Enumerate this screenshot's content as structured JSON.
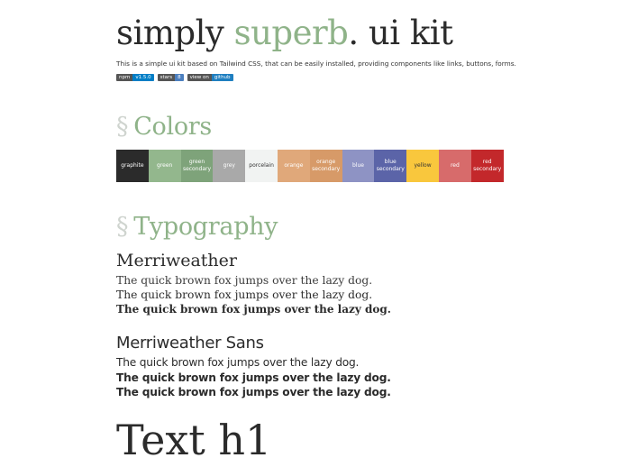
{
  "header": {
    "title_part1": "simply ",
    "title_accent": "superb",
    "title_part2": ". ui kit",
    "intro": "This is a simple ui kit based on Tailwind CSS, that can be easily installed, providing components like links, buttons, forms."
  },
  "badges": [
    {
      "key": "npm",
      "value": "v1.5.0"
    },
    {
      "key": "stars",
      "value": "8"
    },
    {
      "key": "view on",
      "value": "github"
    }
  ],
  "sections": {
    "colors_mark": "§",
    "colors_title": "Colors",
    "typography_mark": "§",
    "typography_title": "Typography"
  },
  "colors": [
    {
      "label": "graphite",
      "hex": "#2b2b2b"
    },
    {
      "label": "green",
      "hex": "#93b78d"
    },
    {
      "label": "green secondary",
      "hex": "#7ea37a"
    },
    {
      "label": "grey",
      "hex": "#a9a9a9"
    },
    {
      "label": "porcelain",
      "hex": "#f1f3f2"
    },
    {
      "label": "orange",
      "hex": "#e0a87a"
    },
    {
      "label": "orange secondary",
      "hex": "#d79a68"
    },
    {
      "label": "blue",
      "hex": "#8e93c4"
    },
    {
      "label": "blue secondary",
      "hex": "#5b64a8"
    },
    {
      "label": "yellow",
      "hex": "#f9c73d"
    },
    {
      "label": "red",
      "hex": "#d76b6b"
    },
    {
      "label": "red secondary",
      "hex": "#c3282b"
    }
  ],
  "typography": {
    "merriweather": {
      "heading": "Merriweather",
      "samples": [
        "The quick brown fox jumps over the lazy dog.",
        "The quick brown fox jumps over the lazy dog.",
        "The quick brown fox jumps over the lazy dog."
      ]
    },
    "merriweather_sans": {
      "heading": "Merriweather Sans",
      "samples": [
        "The quick brown fox jumps over the lazy dog.",
        "The quick brown fox jumps over the lazy dog.",
        "The quick brown fox jumps over the lazy dog."
      ]
    },
    "h1_demo": "Text h1"
  }
}
